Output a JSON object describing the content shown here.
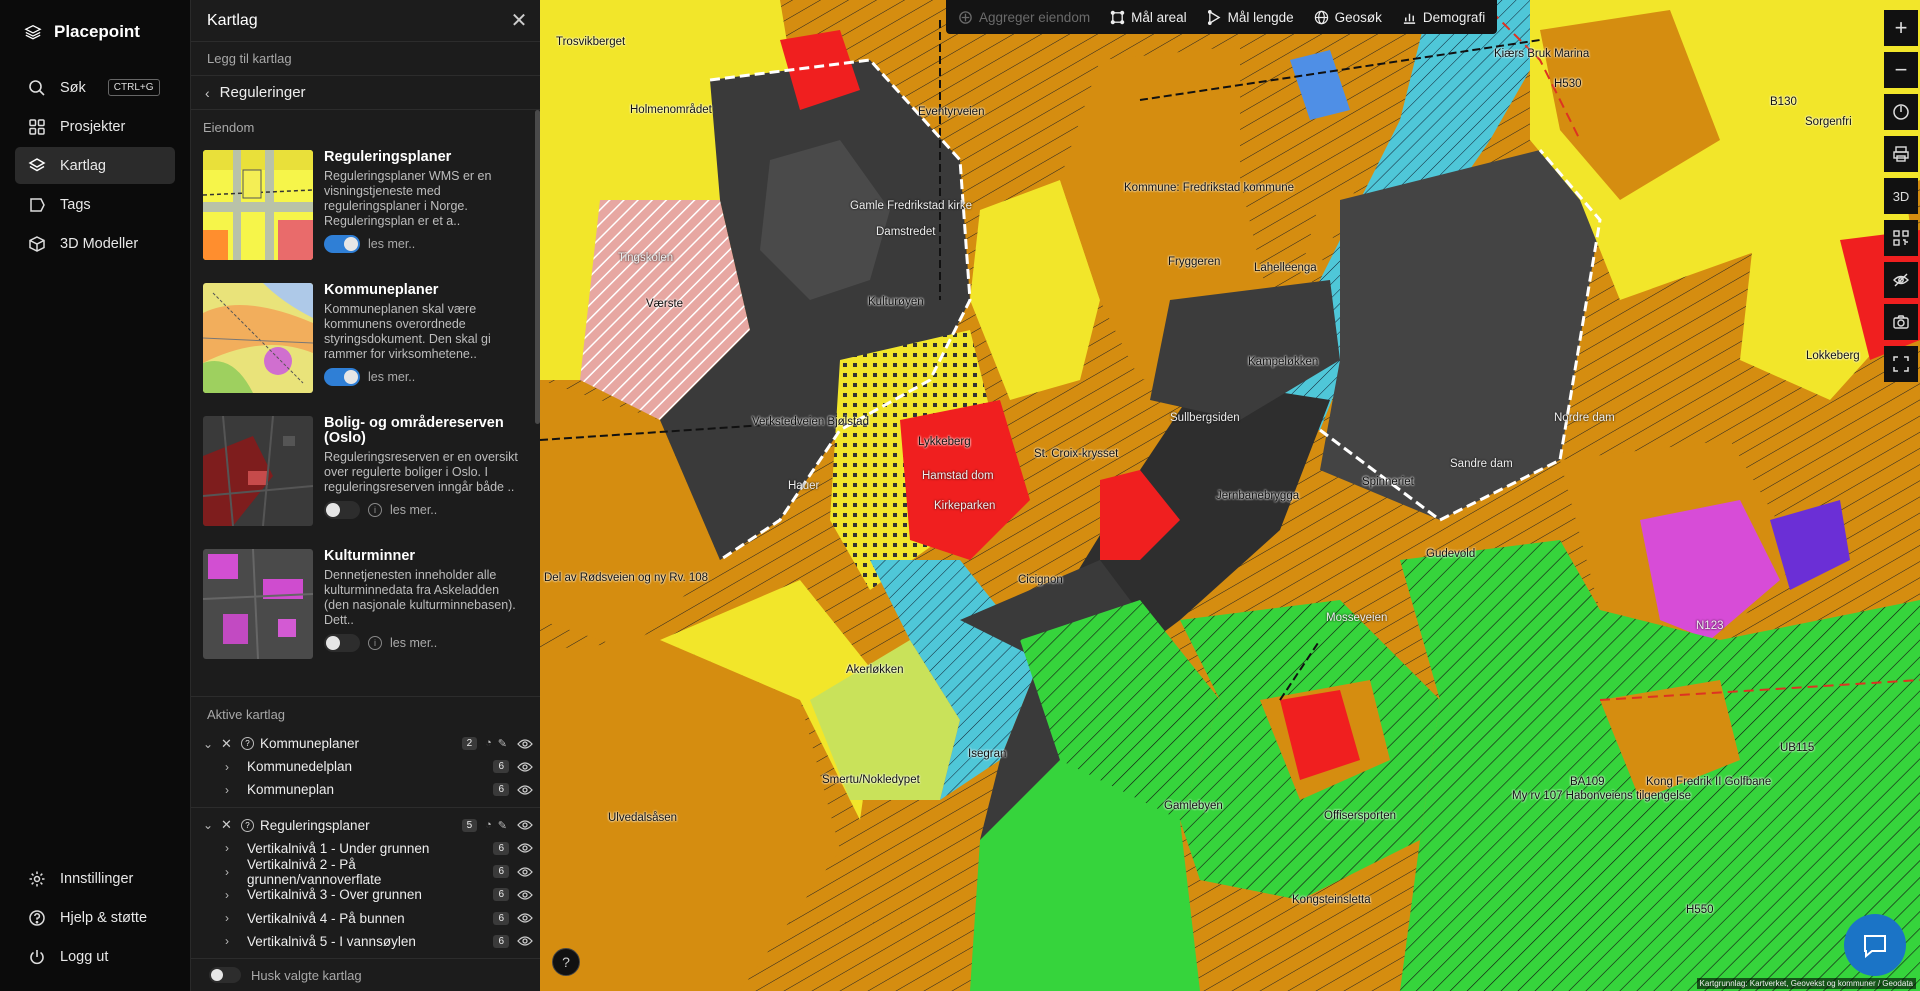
{
  "app": {
    "name": "Placepoint"
  },
  "nav": {
    "items": [
      {
        "label": "Søk",
        "icon": "search-icon",
        "shortcut": "CTRL+G"
      },
      {
        "label": "Prosjekter",
        "icon": "grid-icon"
      },
      {
        "label": "Kartlag",
        "icon": "layers-icon",
        "active": true
      },
      {
        "label": "Tags",
        "icon": "tag-icon"
      },
      {
        "label": "3D Modeller",
        "icon": "cube-icon"
      }
    ],
    "bottom": [
      {
        "label": "Innstillinger",
        "icon": "gear-icon"
      },
      {
        "label": "Hjelp & støtte",
        "icon": "help-icon"
      },
      {
        "label": "Logg ut",
        "icon": "power-icon"
      }
    ]
  },
  "panel": {
    "title": "Kartlag",
    "add_layer": "Legg til kartlag",
    "back_label": "Reguleringer",
    "section": "Eiendom",
    "read_more": "les mer..",
    "cards": [
      {
        "title": "Reguleringsplaner",
        "desc": "Reguleringsplaner WMS er en visningstjeneste med reguleringsplaner i Norge. Reguleringsplan er et a..",
        "enabled": true
      },
      {
        "title": "Kommuneplaner",
        "desc": "Kommuneplanen skal være kommunens overordnede styringsdokument. Den skal gi rammer for virksomhetene..",
        "enabled": true
      },
      {
        "title": "Bolig- og områdereserven (Oslo)",
        "desc": "Reguleringsreserven er en oversikt over regulerte boliger i Oslo. I reguleringsreserven inngår både ..",
        "enabled": false
      },
      {
        "title": "Kulturminner",
        "desc": "Dennetjenesten inneholder alle kulturminnedata fra Askeladden (den nasjonale kulturminnebasen). Dett..",
        "enabled": false
      }
    ],
    "active_label": "Aktive kartlag",
    "groups": [
      {
        "name": "Kommuneplaner",
        "count": "2",
        "items": [
          {
            "name": "Kommunedelplan",
            "count": "6"
          },
          {
            "name": "Kommuneplan",
            "count": "6"
          }
        ]
      },
      {
        "name": "Reguleringsplaner",
        "count": "5",
        "items": [
          {
            "name": "Vertikalnivå 1 - Under grunnen",
            "count": "6"
          },
          {
            "name": "Vertikalnivå 2 - På grunnen/vannoverflate",
            "count": "6"
          },
          {
            "name": "Vertikalnivå 3 - Over grunnen",
            "count": "6"
          },
          {
            "name": "Vertikalnivå 4 - På bunnen",
            "count": "6"
          },
          {
            "name": "Vertikalnivå 5 - I vannsøylen",
            "count": "6"
          }
        ]
      }
    ],
    "remember": "Husk valgte kartlag"
  },
  "toolbar": [
    {
      "label": "Aggreger eiendom",
      "icon": "aggregate-icon",
      "disabled": true
    },
    {
      "label": "Mål areal",
      "icon": "area-icon"
    },
    {
      "label": "Mål lengde",
      "icon": "ruler-icon"
    },
    {
      "label": "Geosøk",
      "icon": "globe-icon"
    },
    {
      "label": "Demografi",
      "icon": "bar-chart-icon"
    }
  ],
  "right_tools": [
    {
      "label": "+",
      "icon": "zoom-in-icon"
    },
    {
      "label": "−",
      "icon": "zoom-out-icon"
    },
    {
      "label": "",
      "icon": "compass-icon"
    },
    {
      "label": "",
      "icon": "print-icon"
    },
    {
      "label": "3D",
      "icon": "3d-icon"
    },
    {
      "label": "",
      "icon": "qr-icon"
    },
    {
      "label": "",
      "icon": "hide-icon"
    },
    {
      "label": "",
      "icon": "camera-icon"
    },
    {
      "label": "",
      "icon": "fullscreen-icon"
    }
  ],
  "map": {
    "labels": [
      "Trosvikberget",
      "Kiærs Bruk Marina",
      "H530",
      "B130",
      "Sorgenfri",
      "Holmenområdet",
      "Eventyrveien",
      "Gamle Fredrikstad kirke",
      "Damstredet",
      "Kommune: Fredrikstad kommune",
      "Fryggeren",
      "Tingskolen",
      "Værste",
      "Kulturøyen",
      "Kampeløkken",
      "Lahelleenga",
      "Lokkeberg",
      "Sullbergsiden",
      "Verkstedveien Bjølstad",
      "Lykkeberg",
      "St. Croix-krysset",
      "Hauer",
      "Hamstad dom",
      "Kirkeparken",
      "Jernbanebrygga",
      "Spinneriet",
      "Cicignon",
      "Gudevold",
      "Del av Rødsveien og ny Rv. 108",
      "Sandre dam",
      "Nordre dam",
      "Mosseveien",
      "N123",
      "Akerløkken",
      "Isegran",
      "Gamlebyen",
      "Smertu/Nokledypet",
      "Ulvedalsåsen",
      "BA109",
      "Kong Fredrik II Golfbane",
      "My rv 107 Habonveiens tilgengelse",
      "Offisersporten",
      "Kongsteinsletta",
      "H550",
      "UB115"
    ],
    "attribution": "Kartgrunnlag: Kartverket, Geovekst og kommuner / Geodata"
  },
  "colors": {
    "accent": "#2f7fd6",
    "sidebar": "#0b0b0b",
    "panel": "#1c1c1c",
    "chat": "#1b74c6"
  }
}
